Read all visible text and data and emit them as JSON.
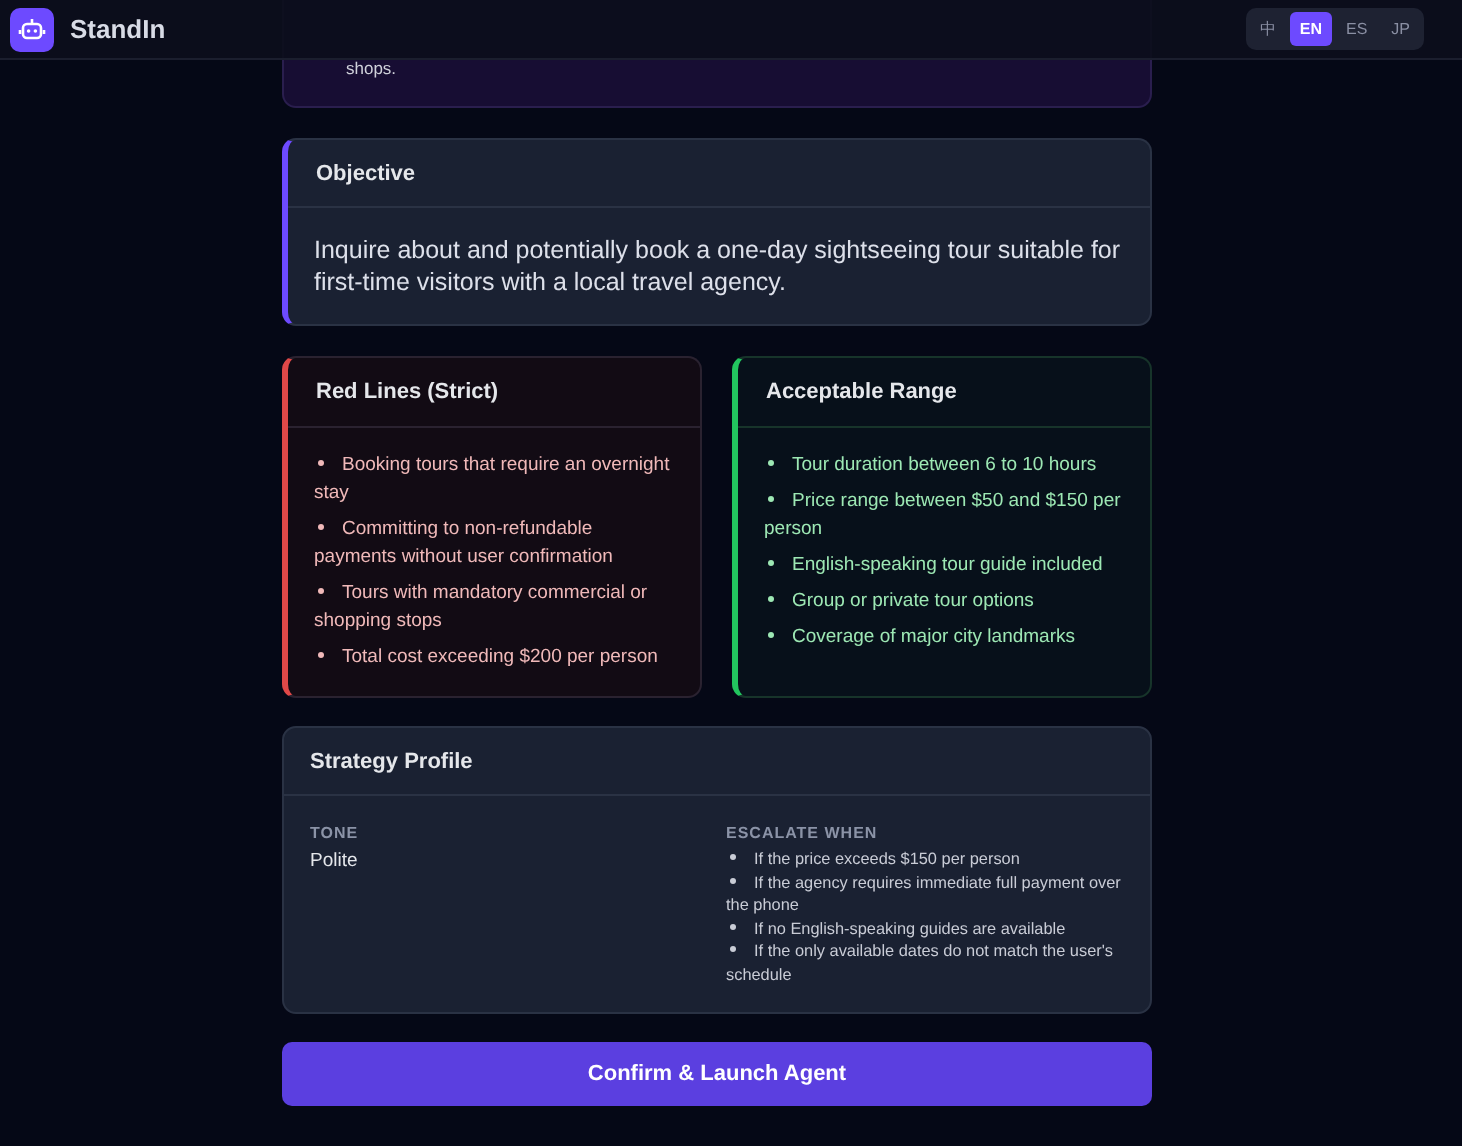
{
  "header": {
    "app_name": "StandIn",
    "languages": [
      {
        "label": "中",
        "selected": false
      },
      {
        "label": "EN",
        "selected": true
      },
      {
        "label": "ES",
        "selected": false
      },
      {
        "label": "JP",
        "selected": false
      }
    ]
  },
  "context_card": {
    "text_tail": "shops."
  },
  "objective": {
    "title": "Objective",
    "text": "Inquire about and potentially book a one-day sightseeing tour suitable for first-time visitors with a local travel agency."
  },
  "red_lines": {
    "title": "Red Lines (Strict)",
    "items": [
      "Booking tours that require an overnight stay",
      "Committing to non-refundable payments without user confirmation",
      "Tours with mandatory commercial or shopping stops",
      "Total cost exceeding $200 per person"
    ]
  },
  "acceptable_range": {
    "title": "Acceptable Range",
    "items": [
      "Tour duration between 6 to 10 hours",
      "Price range between $50 and $150 per person",
      "English-speaking tour guide included",
      "Group or private tour options",
      "Coverage of major city landmarks"
    ]
  },
  "strategy": {
    "title": "Strategy Profile",
    "tone_label": "TONE",
    "tone": "Polite",
    "escalate_label": "ESCALATE WHEN",
    "escalate_items": [
      "If the price exceeds $150 per person",
      "If the agency requires immediate full payment over the phone",
      "If no English-speaking guides are available",
      "If the only available dates do not match the user's schedule"
    ]
  },
  "confirm_button": "Confirm & Launch Agent"
}
